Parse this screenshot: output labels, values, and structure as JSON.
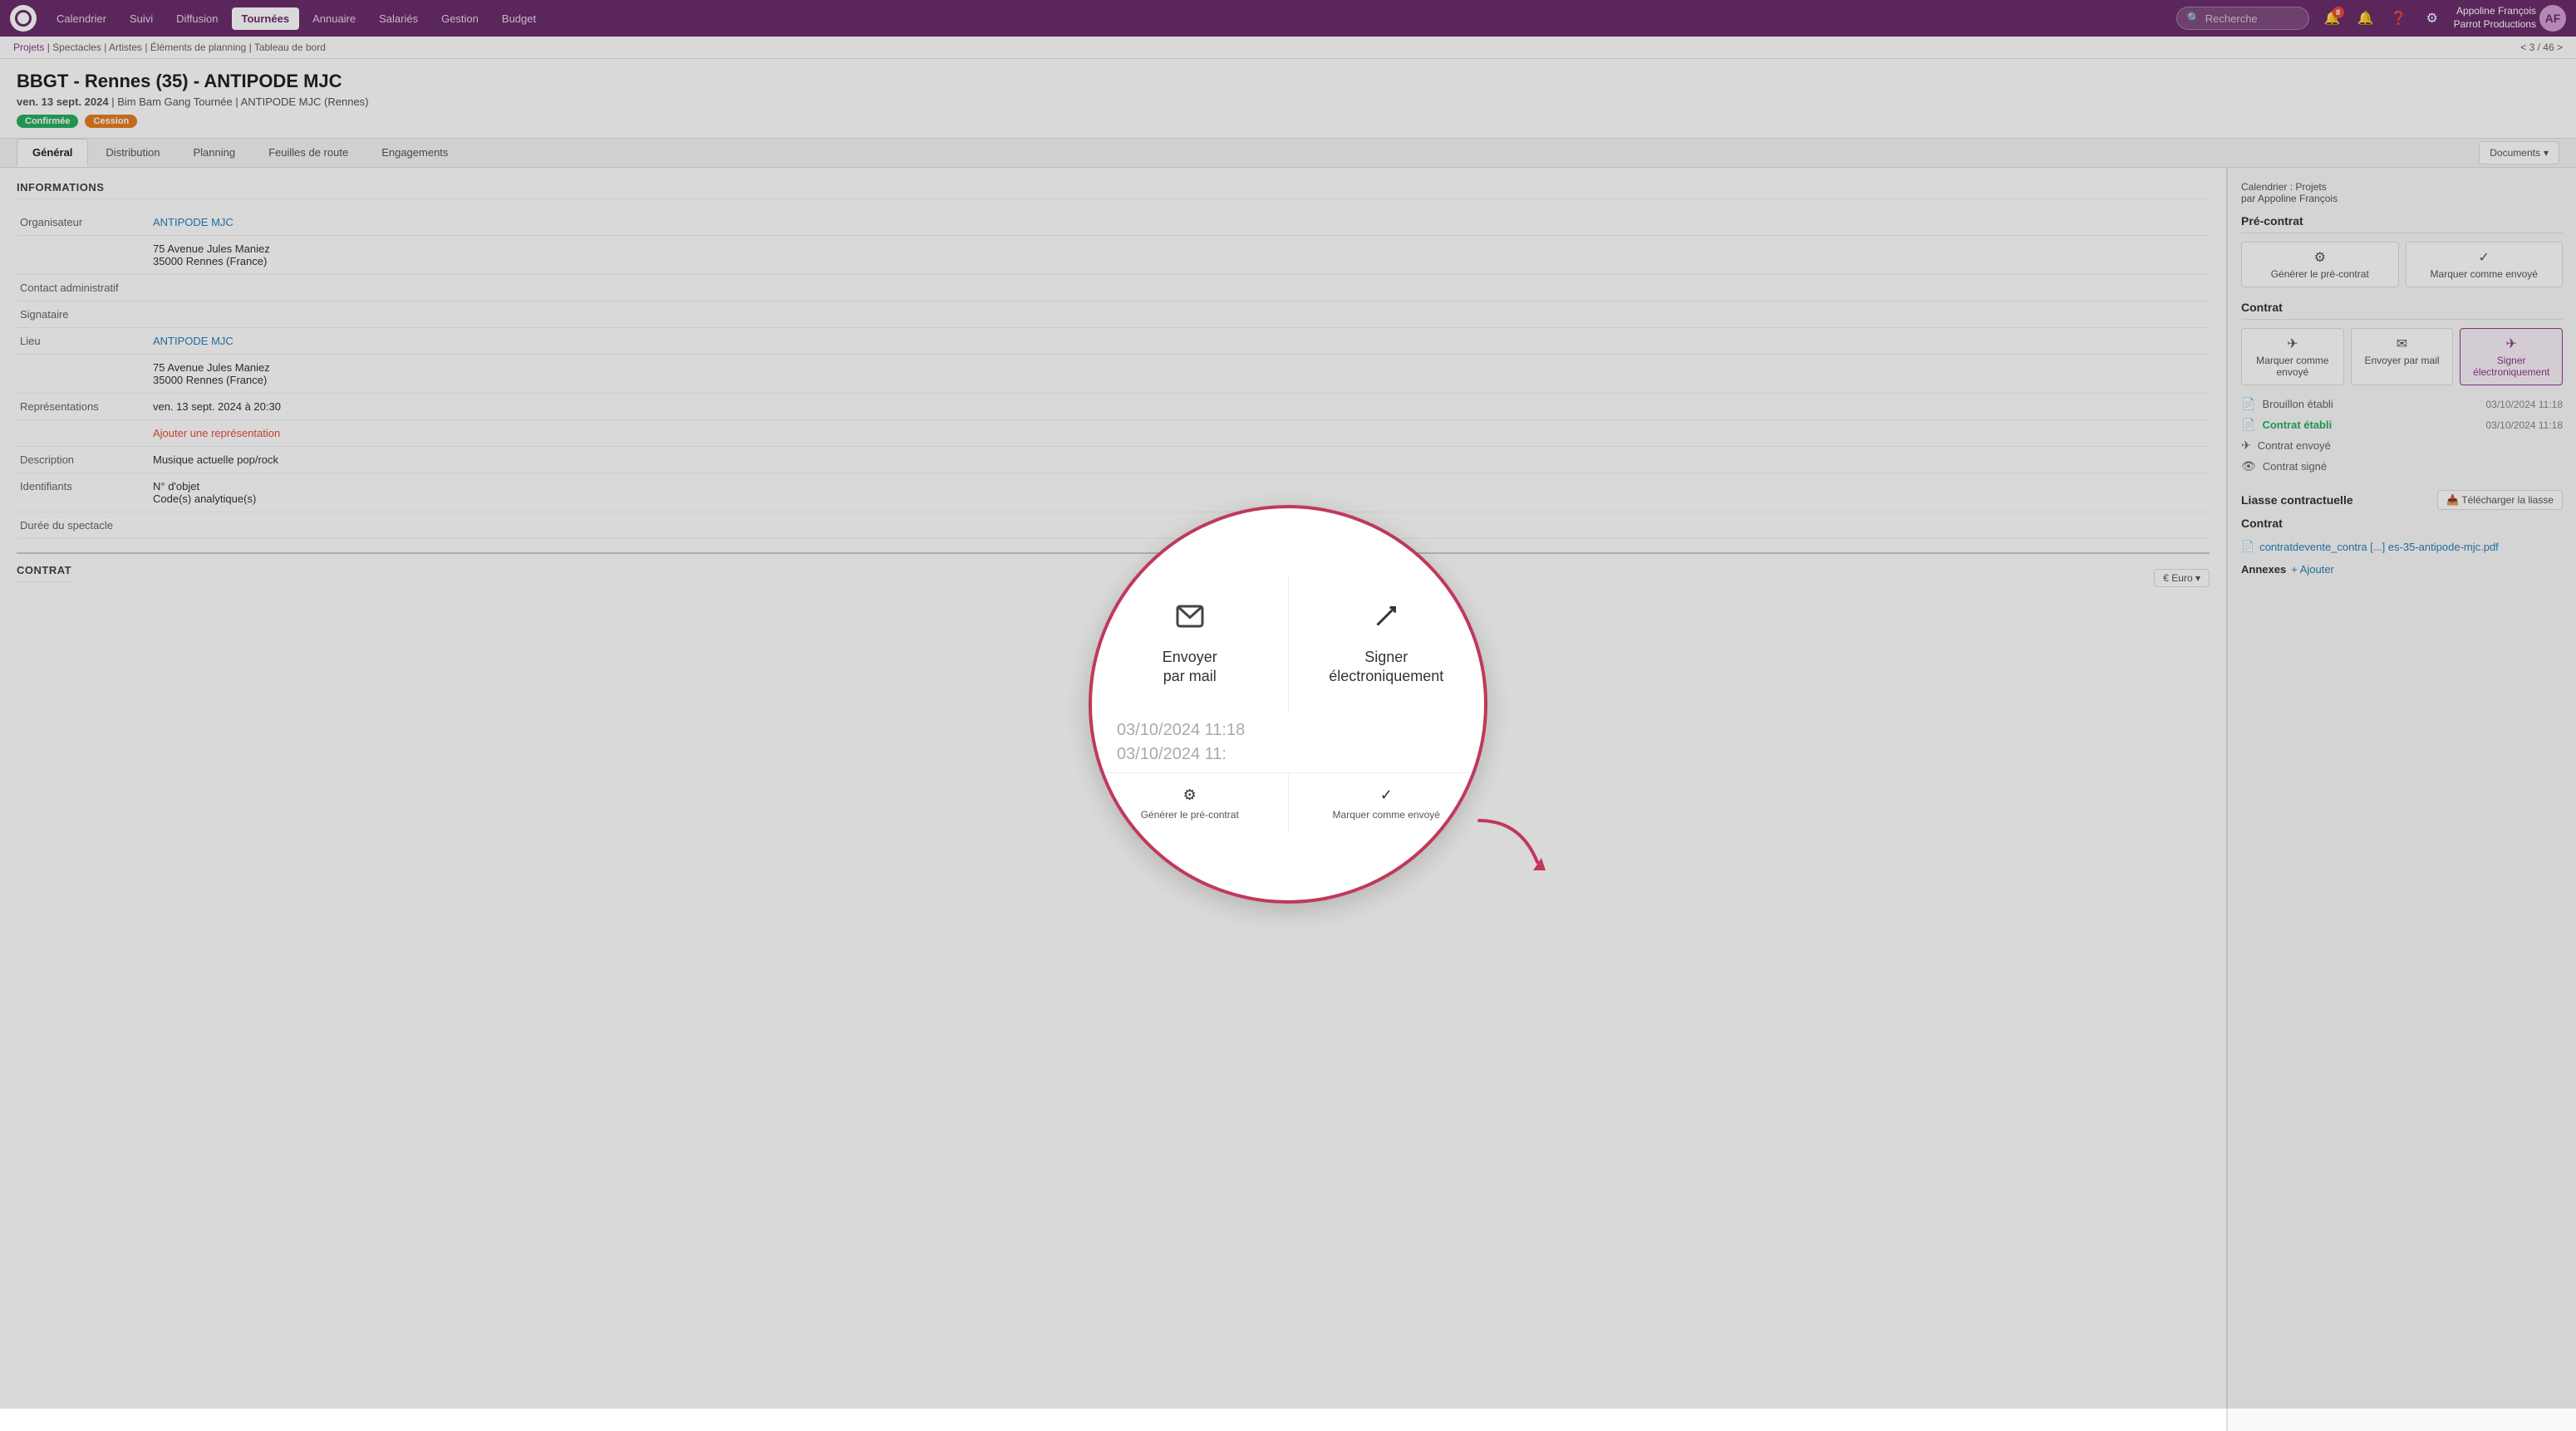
{
  "nav": {
    "logo_alt": "O",
    "items": [
      "Calendrier",
      "Suivi",
      "Diffusion",
      "Tournées",
      "Annuaire",
      "Salariés",
      "Gestion",
      "Budget"
    ],
    "active_item": "Tournées",
    "search_placeholder": "Recherche",
    "notification_badge": "8",
    "user_name": "Appoline François",
    "user_company": "Parrot Productions",
    "user_initials": "AF"
  },
  "breadcrumb": {
    "items": [
      "Projets",
      "Spectacles",
      "Artistes",
      "Éléments de planning",
      "Tableau de bord"
    ],
    "counter": "< 3 / 46 >"
  },
  "page": {
    "title": "BBGT - Rennes (35) - ANTIPODE MJC",
    "subtitle_date": "ven. 13 sept. 2024",
    "subtitle_tour": "Bim Bam Gang Tournée",
    "subtitle_venue": "ANTIPODE MJC",
    "subtitle_city": "Rennes",
    "badge_confirmed": "Confirmée",
    "badge_cession": "Cession"
  },
  "tabs": {
    "items": [
      "Général",
      "Distribution",
      "Planning",
      "Feuilles de route",
      "Engagements"
    ],
    "active": "Général",
    "docs_button": "Documents"
  },
  "info_section": {
    "title": "Informations",
    "fields": [
      {
        "label": "Organisateur",
        "value": "ANTIPODE MJC",
        "is_link": true
      },
      {
        "label": "",
        "value": "75 Avenue Jules Maniez\n35000 Rennes (France)",
        "is_link": false
      },
      {
        "label": "Contact administratif",
        "value": "",
        "is_link": false
      },
      {
        "label": "Signataire",
        "value": "",
        "is_link": false
      },
      {
        "label": "Lieu",
        "value": "ANTIPODE MJC",
        "is_link": true
      },
      {
        "label": "",
        "value": "75 Avenue Jules Maniez\n35000 Rennes (France)",
        "is_link": false
      },
      {
        "label": "Représentations",
        "value": "ven. 13 sept. 2024 à 20:30",
        "is_link": false
      },
      {
        "label": "",
        "value": "Ajouter une représentation",
        "is_link": "add"
      },
      {
        "label": "Description",
        "value": "Musique actuelle pop/rock",
        "is_link": false
      },
      {
        "label": "Identifiants",
        "value": "N° d'objet\nCode(s) analytique(s)",
        "is_link": false
      },
      {
        "label": "Durée du spectacle",
        "value": "",
        "is_link": false
      }
    ]
  },
  "contrat_section": {
    "title": "Contrat",
    "currency": "€ Euro"
  },
  "right_panel": {
    "calendar_label": "Calendrier : Projets",
    "calendar_sub": "par Appoline François",
    "pre_contrat_header": "Pré-contrat",
    "pre_contrat_actions": [
      {
        "icon": "⚙",
        "label": "Générer le pré-contrat"
      },
      {
        "icon": "✓",
        "label": "Marquer comme envoyé"
      }
    ],
    "contrat_header": "Contrat",
    "contrat_actions": [
      {
        "icon": "✈",
        "label": "Marquer comme envoyé"
      },
      {
        "icon": "✉",
        "label": "Envoyer par mail"
      },
      {
        "icon": "✈",
        "label": "Signer électroniquement"
      }
    ],
    "status_items": [
      {
        "icon": "📄",
        "label": "Brouillon établi",
        "date": "03/10/2024 11:18",
        "active": false
      },
      {
        "icon": "📄",
        "label": "Contrat établi",
        "date": "03/10/2024 11:18",
        "active": true
      },
      {
        "icon": "✈",
        "label": "Contrat envoyé",
        "date": "",
        "active": false
      },
      {
        "icon": "👁",
        "label": "Contrat signé",
        "date": "",
        "active": false
      }
    ],
    "liasse_title": "Liasse contractuelle",
    "download_btn": "Télécharger la liasse",
    "contrat_sub": "Contrat",
    "file_link": "contratdevente_contra [...] es-35-antipode-mjc.pdf",
    "annexes_label": "Annexes",
    "annexes_add": "+ Ajouter"
  },
  "popup": {
    "send_by_mail_label": "Envoyer par mail",
    "sign_elec_label": "Signer\nélectroniquement",
    "date_stamp1": "03/10/2024 11:18",
    "date_stamp2": "03/10/2024 11:",
    "action_bar": [
      {
        "icon": "⚙",
        "label": "Générer le pré-contrat"
      },
      {
        "icon": "✓",
        "label": "Marquer comme envoyé"
      }
    ]
  }
}
